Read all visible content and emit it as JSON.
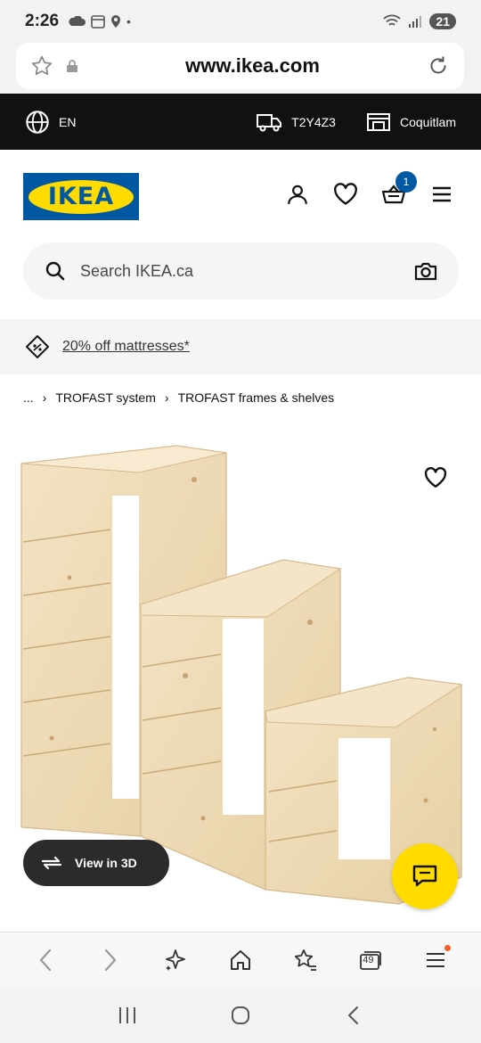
{
  "status": {
    "time": "2:26",
    "battery": "21"
  },
  "browser": {
    "url": "www.ikea.com",
    "tabs_count": "49"
  },
  "topbar": {
    "language": "EN",
    "postal_code": "T2Y4Z3",
    "store": "Coquitlam"
  },
  "header": {
    "logo": "IKEA",
    "cart_count": "1"
  },
  "search": {
    "placeholder": "Search IKEA.ca"
  },
  "promo": {
    "text": "20% off mattresses*"
  },
  "breadcrumb": {
    "ellipsis": "...",
    "items": [
      "TROFAST system",
      "TROFAST frames & shelves"
    ]
  },
  "product": {
    "view3d_label": "View in 3D"
  },
  "colors": {
    "ikea_blue": "#0058a3",
    "ikea_yellow": "#ffdb00"
  }
}
